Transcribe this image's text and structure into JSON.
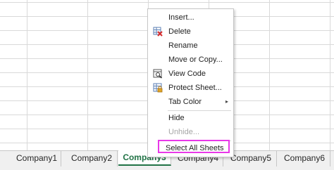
{
  "context_menu": {
    "items": [
      {
        "label": "Insert...",
        "icon": "",
        "enabled": true
      },
      {
        "label": "Delete",
        "icon": "delete-sheet-icon",
        "enabled": true
      },
      {
        "label": "Rename",
        "icon": "",
        "enabled": true
      },
      {
        "label": "Move or Copy...",
        "icon": "",
        "enabled": true
      },
      {
        "label": "View Code",
        "icon": "view-code-icon",
        "enabled": true
      },
      {
        "label": "Protect Sheet...",
        "icon": "protect-sheet-icon",
        "enabled": true
      },
      {
        "label": "Tab Color",
        "icon": "",
        "enabled": true,
        "submenu": true
      },
      {
        "label": "Hide",
        "icon": "",
        "enabled": true
      },
      {
        "label": "Unhide...",
        "icon": "",
        "enabled": false
      },
      {
        "label": "Select All Sheets",
        "icon": "",
        "enabled": true,
        "highlighted": true
      }
    ],
    "submenu_arrow": "▸"
  },
  "sheet_tabs": [
    {
      "label": "Company1",
      "active": false
    },
    {
      "label": "Company2",
      "active": false
    },
    {
      "label": "Company3",
      "active": true
    },
    {
      "label": "Company4",
      "active": false
    },
    {
      "label": "Company5",
      "active": false
    },
    {
      "label": "Company6",
      "active": false
    }
  ],
  "colors": {
    "active_tab": "#217346",
    "highlight_border": "#e838e8"
  }
}
